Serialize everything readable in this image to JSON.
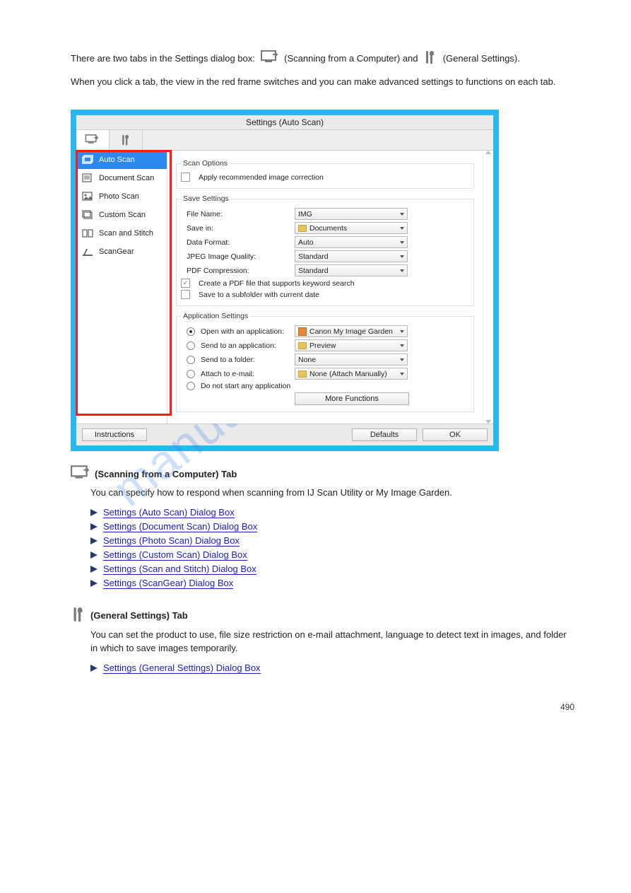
{
  "intro_pre": "There are two tabs in the Settings dialog box:",
  "intro_mid": "(Scanning from a Computer) and",
  "intro_post": "(General Settings).",
  "intro2": "When you click a tab, the view in the red frame switches and you can make advanced settings to functions on each tab.",
  "window_title": "Settings (Auto Scan)",
  "sidebar": [
    "Auto Scan",
    "Document Scan",
    "Photo Scan",
    "Custom Scan",
    "Scan and Stitch",
    "ScanGear"
  ],
  "scan_options_title": "Scan Options",
  "scan_options_cb": "Apply recommended image correction",
  "save_settings_title": "Save Settings",
  "fields": {
    "file_name_l": "File Name:",
    "file_name_v": "IMG",
    "save_in_l": "Save in:",
    "save_in_v": "Documents",
    "data_format_l": "Data Format:",
    "data_format_v": "Auto",
    "jpeg_l": "JPEG Image Quality:",
    "jpeg_v": "Standard",
    "pdf_l": "PDF Compression:",
    "pdf_v": "Standard"
  },
  "cb_pdf": "Create a PDF file that supports keyword search",
  "cb_subfolder": "Save to a subfolder with current date",
  "app_settings_title": "Application Settings",
  "radios": {
    "open_l": "Open with an application:",
    "open_v": "Canon My Image Garden",
    "send_app_l": "Send to an application:",
    "send_app_v": "Preview",
    "send_folder_l": "Send to a folder:",
    "send_folder_v": "None",
    "email_l": "Attach to e-mail:",
    "email_v": "None (Attach Manually)",
    "nostart_l": "Do not start any application"
  },
  "more_functions": "More Functions",
  "btn_instructions": "Instructions",
  "btn_defaults": "Defaults",
  "btn_ok": "OK",
  "section_scan_tab_title": "(Scanning from a Computer) Tab",
  "section_scan_tab_p": "You can specify how to respond when scanning from IJ Scan Utility or My Image Garden.",
  "links_scan": [
    "Settings (Auto Scan) Dialog Box",
    "Settings (Document Scan) Dialog Box",
    "Settings (Photo Scan) Dialog Box",
    "Settings (Custom Scan) Dialog Box",
    "Settings (Scan and Stitch) Dialog Box",
    "Settings (ScanGear) Dialog Box"
  ],
  "section_general_title": "(General Settings) Tab",
  "section_general_p": "You can set the product to use, file size restriction on e-mail attachment, language to detect text in images, and folder in which to save images temporarily.",
  "link_general": "Settings (General Settings) Dialog Box",
  "pagenum": "490",
  "watermark": "manualshive.com"
}
